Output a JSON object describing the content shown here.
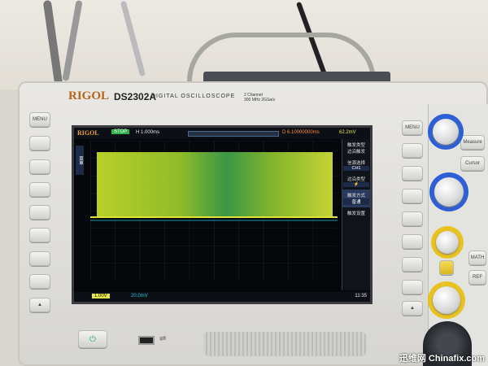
{
  "brand": "RIGOL",
  "model": "DS2302A",
  "subtitle": "DIGITAL OSCILLOSCOPE",
  "spec_line1": "2 Channel",
  "spec_line2": "300 MHz 2GSa/s",
  "screen": {
    "logo": "RIGOL",
    "run_state": "STOP",
    "timebase": "H 1.000ms",
    "delay": "D 6.10000000ms",
    "trigger_level": "62.2mV",
    "ch1_scale": "1.00V",
    "ch2_scale": "20.0mV",
    "clock": "11:35",
    "left_label": "菜单",
    "menu_title": "触发设置",
    "menu": [
      {
        "label": "触发类型",
        "value": "边沿触发"
      },
      {
        "label": "信源选择",
        "value": "CH1"
      },
      {
        "label": "边沿类型",
        "value": "⚡"
      },
      {
        "label": "触发方式",
        "value": "普通"
      },
      {
        "label": "触发设置",
        "value": ""
      }
    ]
  },
  "buttons": {
    "left_menu": "MENU",
    "right_menu": "MENU",
    "measure": "Measure",
    "cursor": "Cursor",
    "math": "MATH",
    "ref": "REF"
  },
  "colors": {
    "waveform": "#c8e02a",
    "waveform_green": "#3fa24a",
    "brand": "#b7651c"
  },
  "watermark": "迅维网 Chinafix.com"
}
